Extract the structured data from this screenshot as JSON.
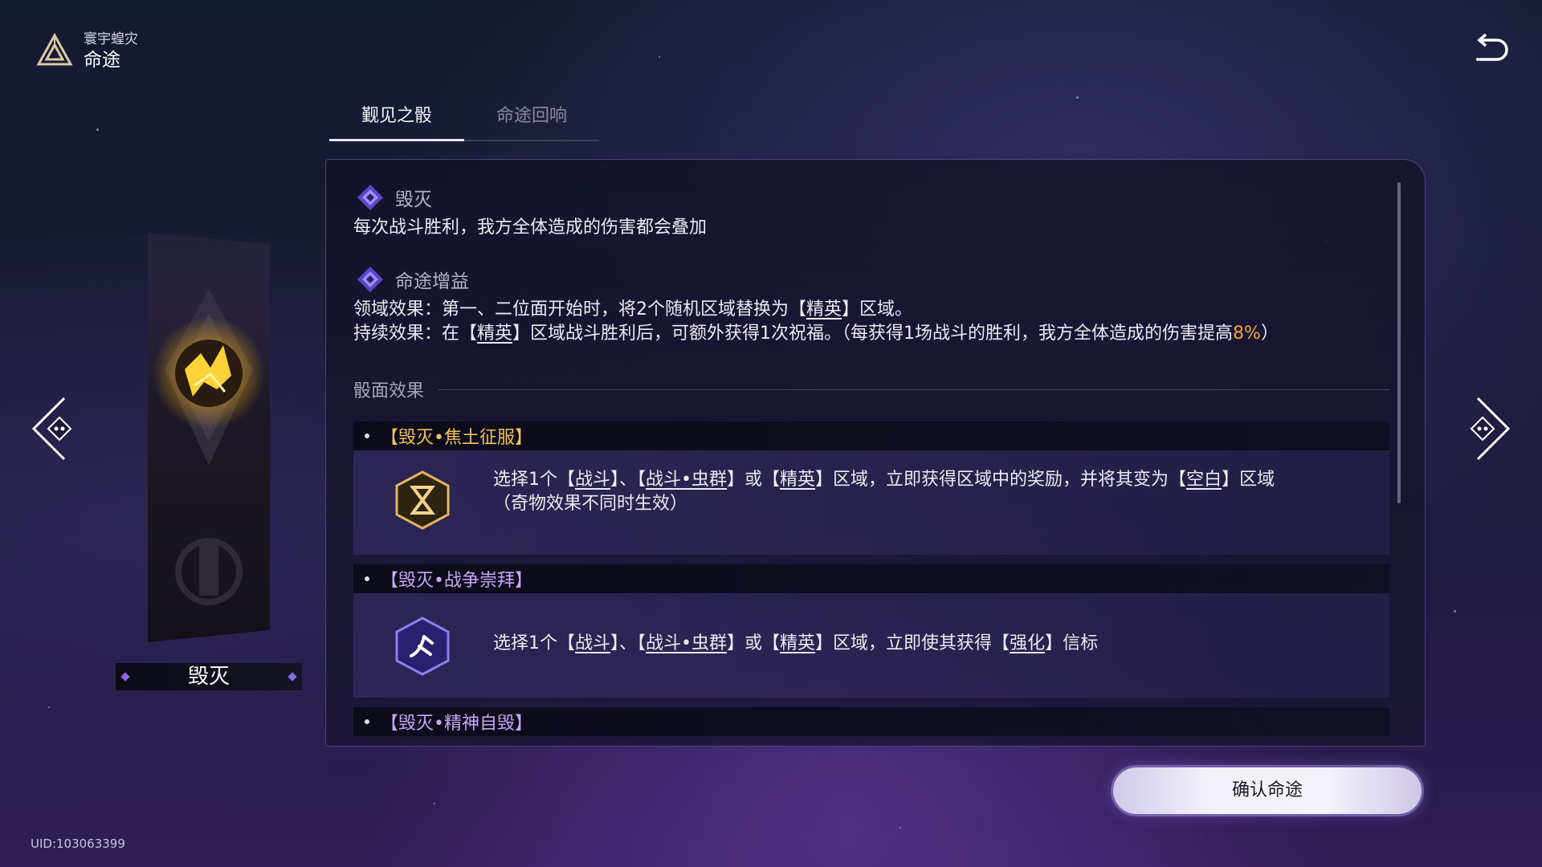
{
  "header": {
    "subtitle": "寰宇蝗灾",
    "title": "命途"
  },
  "tabs": [
    {
      "label": "觐见之骰",
      "active": true
    },
    {
      "label": "命途回响",
      "active": false
    }
  ],
  "path": {
    "name": "毁灭",
    "description": "每次战斗胜利，我方全体造成的伤害都会叠加",
    "bonus_heading": "命途增益",
    "domain_effect": {
      "prefix": "领域效果：第一、二位面开始时，将2个随机区域替换为【",
      "term": "精英",
      "suffix": "】区域。"
    },
    "lasting_effect": {
      "prefix": "持续效果：在【",
      "term": "精英",
      "middle": "】区域战斗胜利后，可额外获得1次祝福。（每获得1场战斗的胜利，我方全体造成的伤害提高",
      "percent": "8%",
      "suffix": "）"
    }
  },
  "dice_section": {
    "heading": "骰面效果",
    "effects": [
      {
        "title": "【毁灭•焦土征服】",
        "title_color": "#f2c15a",
        "icon": "hourglass-rune-icon",
        "line1": {
          "t1": "选择1个【",
          "k1": "战斗",
          "t2": "】、【",
          "k2": "战斗•虫群",
          "t3": "】或【",
          "k3": "精英",
          "t4": "】区域，立即获得区域中的奖励，并将其变为【",
          "k4": "空白",
          "t5": "】区域"
        },
        "line2": "（奇物效果不同时生效）"
      },
      {
        "title": "【毁灭•战争崇拜】",
        "title_color": "#c9a6f5",
        "icon": "war-blade-icon",
        "line1": {
          "t1": "选择1个【",
          "k1": "战斗",
          "t2": "】、【",
          "k2": "战斗•虫群",
          "t3": "】或【",
          "k3": "精英",
          "t4": "】区域，立即使其获得【",
          "k4": "强化",
          "t5": "】信标"
        }
      },
      {
        "title": "【毁灭•精神自毁】",
        "title_color": "#c9a6f5"
      }
    ]
  },
  "confirm_button": "确认命途",
  "uid": "UID:103063399",
  "colors": {
    "accent_gold": "#f0a23e",
    "accent_purple": "#8c6ae6"
  }
}
